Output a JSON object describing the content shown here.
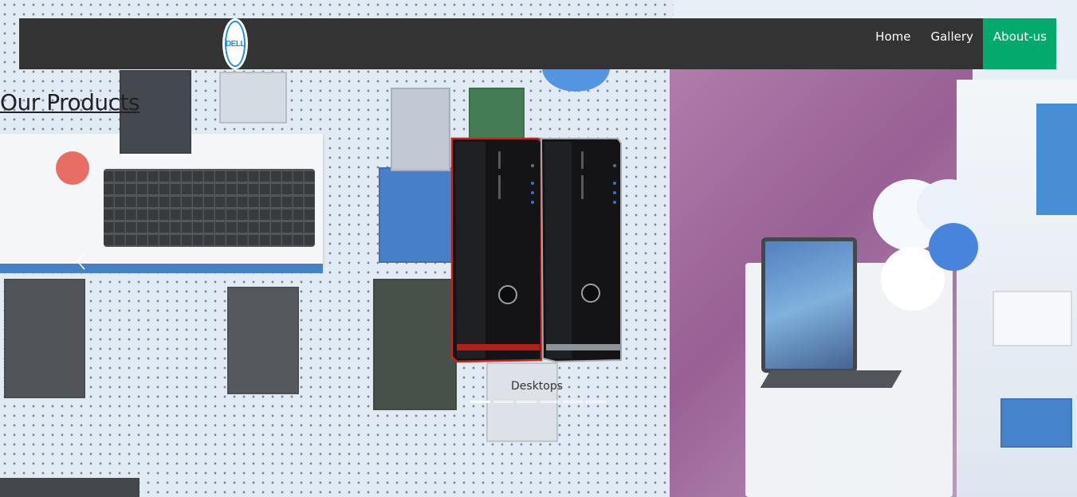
{
  "navbar": {
    "logo_text": "DELL",
    "items": [
      {
        "label": "Home",
        "active": false
      },
      {
        "label": "Gallery",
        "active": false
      },
      {
        "label": "About-us",
        "active": true
      }
    ],
    "background_color": "#333333",
    "active_color": "#04aa6d"
  },
  "main": {
    "title": "Our Products"
  },
  "carousel": {
    "slide_caption": "Desktops",
    "product_icon": "desktop-tower-icon",
    "prev_icon": "chevron-left-icon",
    "slide_count": 6,
    "active_slide": 1
  }
}
